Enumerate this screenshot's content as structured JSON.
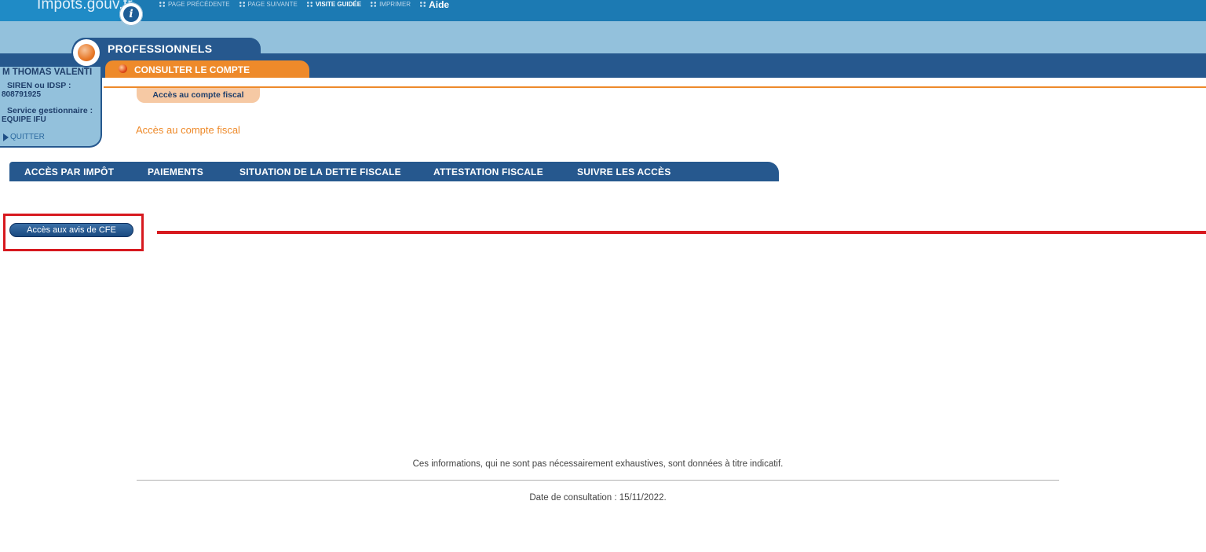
{
  "header": {
    "logo_text": "Impots.gouv.fr",
    "info_badge": "i",
    "links": [
      {
        "label": "PAGE PRÉCÉDENTE"
      },
      {
        "label": "PAGE SUIVANTE"
      },
      {
        "label": "VISITE GUIDÉE"
      },
      {
        "label": "IMPRIMER"
      },
      {
        "label": "Aide"
      }
    ]
  },
  "section": {
    "label": "PROFESSIONNELS",
    "tab_label": "CONSULTER LE COMPTE"
  },
  "user": {
    "name": "M THOMAS VALENTI",
    "siren_label": "SIREN ou IDSP :",
    "siren_value": "808791925",
    "service_label": "Service gestionnaire :",
    "service_value": "EQUIPE IFU",
    "quit_label": "QUITTER"
  },
  "breadcrumb": "Accès au compte fiscal",
  "page_title": "Accès au compte fiscal",
  "nav": [
    {
      "label": "ACCÈS PAR IMPÔT"
    },
    {
      "label": "PAIEMENTS"
    },
    {
      "label": "SITUATION DE LA DETTE FISCALE"
    },
    {
      "label": "ATTESTATION FISCALE"
    },
    {
      "label": "SUIVRE LES ACCÈS"
    }
  ],
  "cfe_button_label": "Accès aux avis de CFE",
  "footer": {
    "disclaimer": "Ces informations, qui ne sont pas nécessairement exhaustives, sont données à titre indicatif.",
    "consultation_date": "Date de consultation : 15/11/2022."
  },
  "colors": {
    "primary_blue": "#26588e",
    "light_blue": "#93c1dc",
    "orange": "#ee8a2a",
    "annotation_red": "#d7191f"
  }
}
